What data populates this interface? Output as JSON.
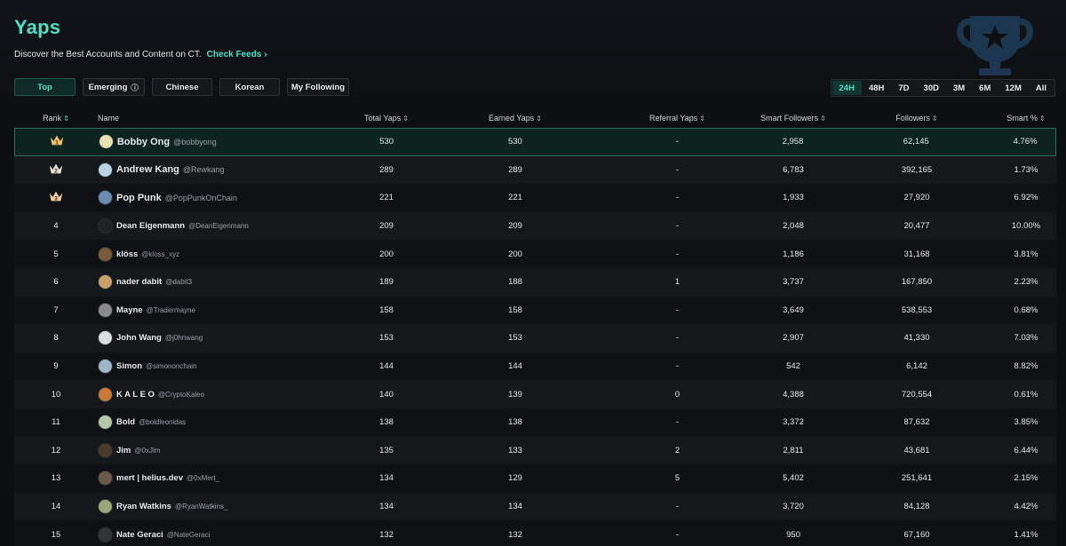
{
  "header": {
    "title": "Yaps",
    "subtitle": "Discover the Best Accounts and Content on CT.",
    "check_feeds": "Check Feeds"
  },
  "tabs": [
    {
      "label": "Top",
      "active": true
    },
    {
      "label": "Emerging",
      "info_icon": "info-circle-icon"
    },
    {
      "label": "Chinese"
    },
    {
      "label": "Korean"
    },
    {
      "label": "My Following"
    }
  ],
  "timeframes": [
    {
      "label": "24H",
      "active": true
    },
    {
      "label": "48H"
    },
    {
      "label": "7D"
    },
    {
      "label": "30D"
    },
    {
      "label": "3M"
    },
    {
      "label": "6M"
    },
    {
      "label": "12M"
    },
    {
      "label": "All"
    }
  ],
  "columns": {
    "rank": "Rank",
    "name": "Name",
    "total": "Total Yaps",
    "earned": "Earned Yaps",
    "referral": "Referral Yaps",
    "smart_followers": "Smart Followers",
    "followers": "Followers",
    "smart_pct": "Smart %"
  },
  "colors": {
    "accent": "#4fe0c7",
    "crown_gold": "#f3c06a",
    "crown_silver": "#e6e0d6",
    "crown_bronze": "#f0c9a0"
  },
  "rows": [
    {
      "rank": "1",
      "name": "Bobby Ong",
      "handle": "@bobbyong",
      "total": "530",
      "earned": "530",
      "referral": "-",
      "smart_followers": "2,958",
      "followers": "62,145",
      "smart_pct": "4.76%"
    },
    {
      "rank": "2",
      "name": "Andrew Kang",
      "handle": "@Rewkang",
      "total": "289",
      "earned": "289",
      "referral": "-",
      "smart_followers": "6,783",
      "followers": "392,165",
      "smart_pct": "1.73%"
    },
    {
      "rank": "3",
      "name": "Pop Punk",
      "handle": "@PopPunkOnChain",
      "total": "221",
      "earned": "221",
      "referral": "-",
      "smart_followers": "1,933",
      "followers": "27,920",
      "smart_pct": "6.92%"
    },
    {
      "rank": "4",
      "name": "Dean Eigenmann",
      "handle": "@DeanEigenmann",
      "total": "209",
      "earned": "209",
      "referral": "-",
      "smart_followers": "2,048",
      "followers": "20,477",
      "smart_pct": "10.00%"
    },
    {
      "rank": "5",
      "name": "klöss",
      "handle": "@kloss_xyz",
      "total": "200",
      "earned": "200",
      "referral": "-",
      "smart_followers": "1,186",
      "followers": "31,168",
      "smart_pct": "3.81%"
    },
    {
      "rank": "6",
      "name": "nader dabit",
      "handle": "@dabit3",
      "total": "189",
      "earned": "188",
      "referral": "1",
      "smart_followers": "3,737",
      "followers": "167,850",
      "smart_pct": "2.23%"
    },
    {
      "rank": "7",
      "name": "Mayne",
      "handle": "@Tradermayne",
      "total": "158",
      "earned": "158",
      "referral": "-",
      "smart_followers": "3,649",
      "followers": "538,553",
      "smart_pct": "0.68%"
    },
    {
      "rank": "8",
      "name": "John Wang",
      "handle": "@j0hnwang",
      "total": "153",
      "earned": "153",
      "referral": "-",
      "smart_followers": "2,907",
      "followers": "41,330",
      "smart_pct": "7.03%"
    },
    {
      "rank": "9",
      "name": "Simon",
      "handle": "@simononchain",
      "total": "144",
      "earned": "144",
      "referral": "-",
      "smart_followers": "542",
      "followers": "6,142",
      "smart_pct": "8.82%"
    },
    {
      "rank": "10",
      "name": "K A L E O",
      "handle": "@CryptoKaleo",
      "total": "140",
      "earned": "139",
      "referral": "0",
      "smart_followers": "4,388",
      "followers": "720,554",
      "smart_pct": "0.61%"
    },
    {
      "rank": "11",
      "name": "Bold",
      "handle": "@boldleonidas",
      "total": "138",
      "earned": "138",
      "referral": "-",
      "smart_followers": "3,372",
      "followers": "87,632",
      "smart_pct": "3.85%"
    },
    {
      "rank": "12",
      "name": "Jim",
      "handle": "@0xJim",
      "total": "135",
      "earned": "133",
      "referral": "2",
      "smart_followers": "2,811",
      "followers": "43,681",
      "smart_pct": "6.44%"
    },
    {
      "rank": "13",
      "name": "mert | helius.dev",
      "handle": "@0xMert_",
      "total": "134",
      "earned": "129",
      "referral": "5",
      "smart_followers": "5,402",
      "followers": "251,641",
      "smart_pct": "2.15%"
    },
    {
      "rank": "14",
      "name": "Ryan Watkins",
      "handle": "@RyanWatkins_",
      "total": "134",
      "earned": "134",
      "referral": "-",
      "smart_followers": "3,720",
      "followers": "84,128",
      "smart_pct": "4.42%"
    },
    {
      "rank": "15",
      "name": "Nate Geraci",
      "handle": "@NateGeraci",
      "total": "132",
      "earned": "132",
      "referral": "-",
      "smart_followers": "950",
      "followers": "67,160",
      "smart_pct": "1.41%"
    }
  ]
}
